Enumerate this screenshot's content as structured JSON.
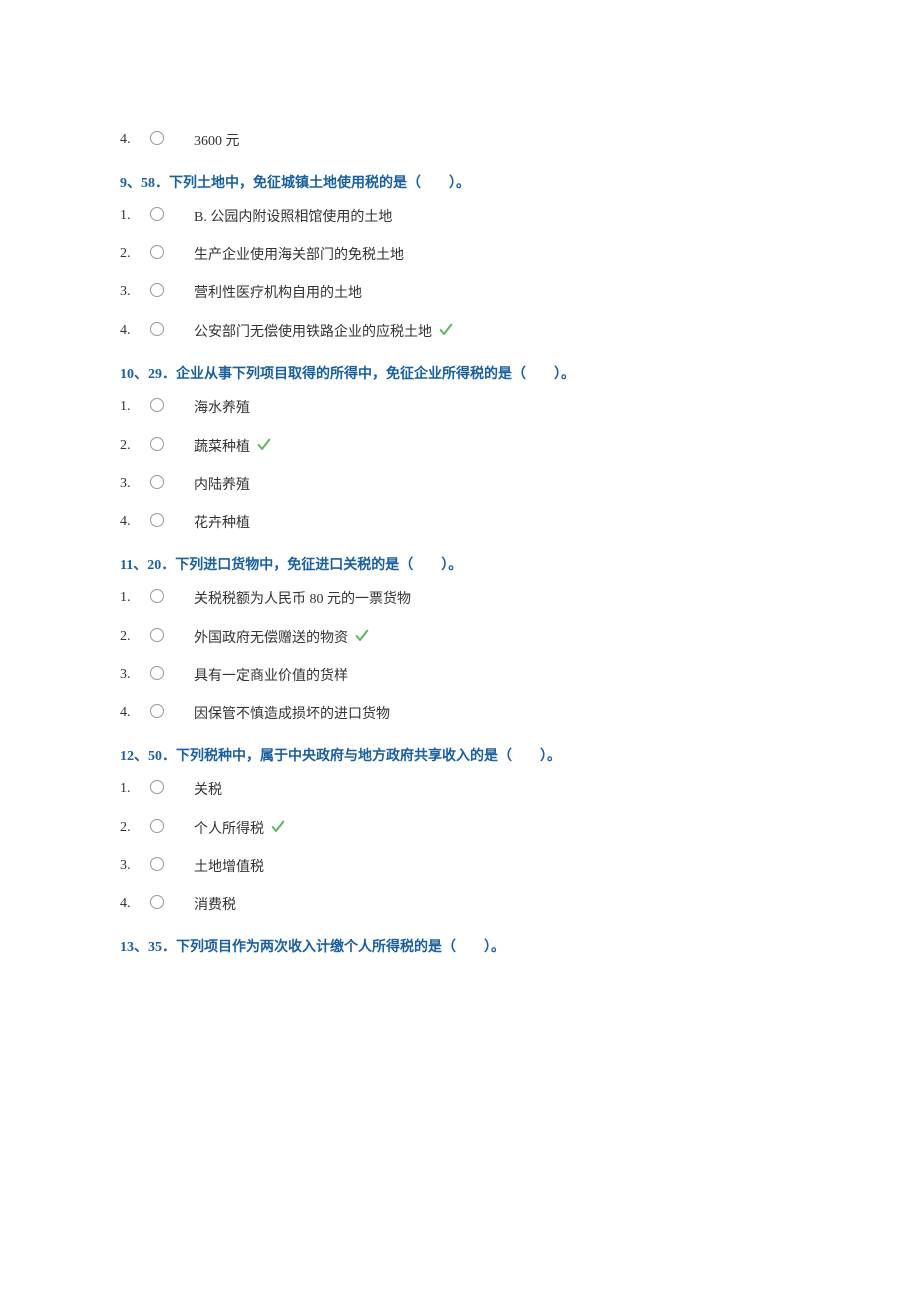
{
  "questions": [
    {
      "title": "",
      "options": [
        {
          "num": "4.",
          "text": "3600 元",
          "correct": false
        }
      ]
    },
    {
      "title": "9、58．下列土地中，免征城镇土地使用税的是（　　）。",
      "options": [
        {
          "num": "1.",
          "text": "B. 公园内附设照相馆使用的土地",
          "correct": false
        },
        {
          "num": "2.",
          "text": "生产企业使用海关部门的免税土地",
          "correct": false
        },
        {
          "num": "3.",
          "text": "营利性医疗机构自用的土地",
          "correct": false
        },
        {
          "num": "4.",
          "text": "公安部门无偿使用铁路企业的应税土地",
          "correct": true
        }
      ]
    },
    {
      "title": "10、29．企业从事下列项目取得的所得中，免征企业所得税的是（　　）。",
      "options": [
        {
          "num": "1.",
          "text": "海水养殖",
          "correct": false
        },
        {
          "num": "2.",
          "text": "蔬菜种植",
          "correct": true
        },
        {
          "num": "3.",
          "text": "内陆养殖",
          "correct": false
        },
        {
          "num": "4.",
          "text": "花卉种植",
          "correct": false
        }
      ]
    },
    {
      "title": "11、20．下列进口货物中，免征进口关税的是（　　）。",
      "options": [
        {
          "num": "1.",
          "text": "关税税额为人民币 80 元的一票货物",
          "correct": false
        },
        {
          "num": "2.",
          "text": "外国政府无偿赠送的物资",
          "correct": true
        },
        {
          "num": "3.",
          "text": "具有一定商业价值的货样",
          "correct": false
        },
        {
          "num": "4.",
          "text": "因保管不慎造成损坏的进口货物",
          "correct": false
        }
      ]
    },
    {
      "title": "12、50．下列税种中，属于中央政府与地方政府共享收入的是（　　）。",
      "options": [
        {
          "num": "1.",
          "text": "关税",
          "correct": false
        },
        {
          "num": "2.",
          "text": "个人所得税",
          "correct": true
        },
        {
          "num": "3.",
          "text": "土地增值税",
          "correct": false
        },
        {
          "num": "4.",
          "text": "消费税",
          "correct": false
        }
      ]
    },
    {
      "title": "13、35．下列项目作为两次收入计缴个人所得税的是（　　）。",
      "options": []
    }
  ]
}
